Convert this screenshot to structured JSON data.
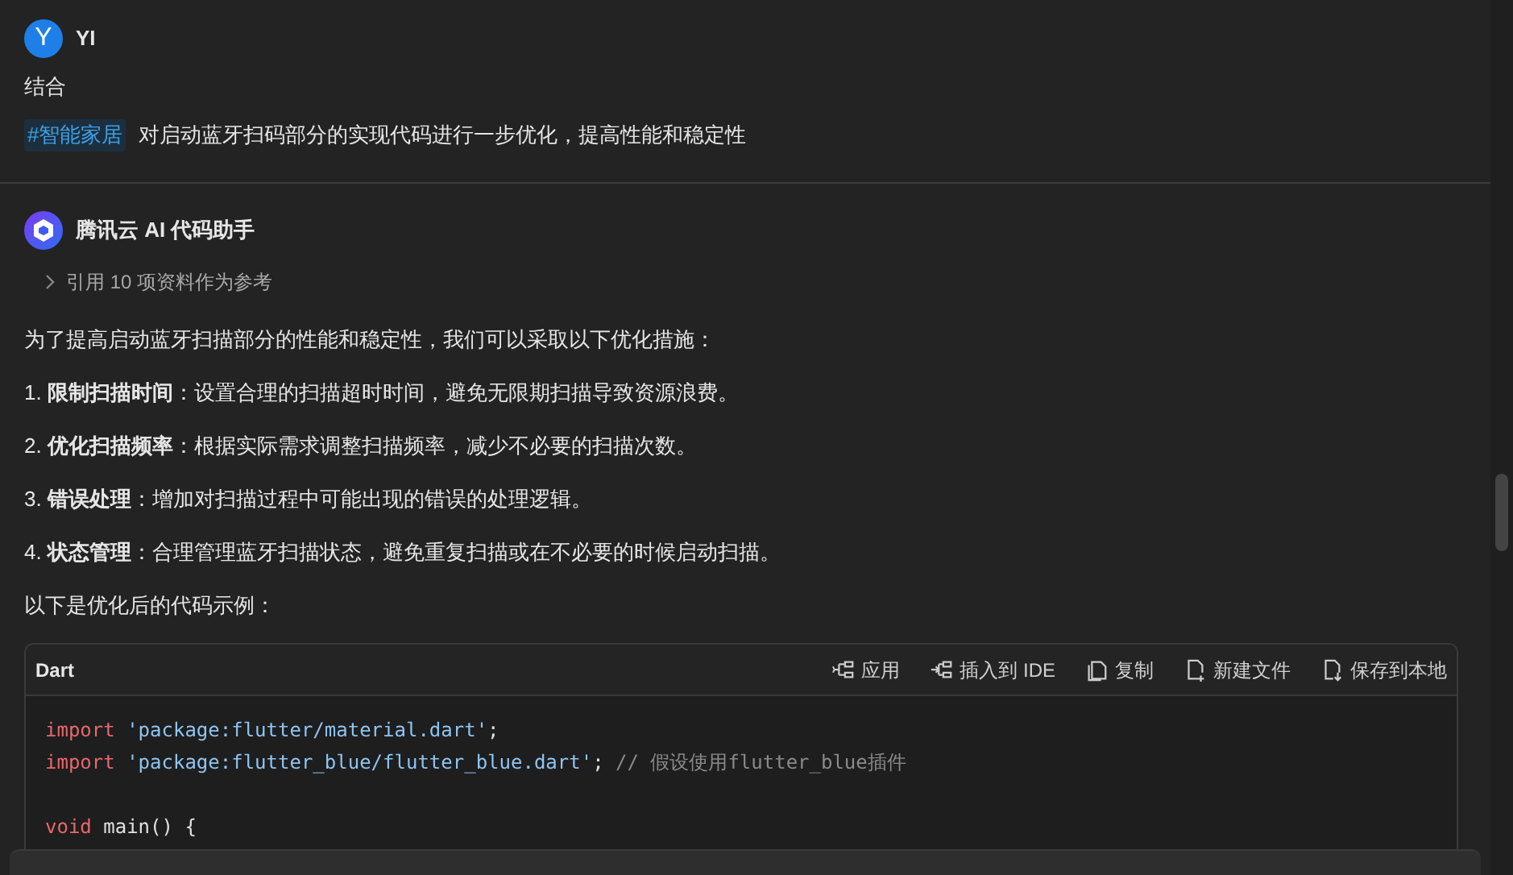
{
  "user_message": {
    "avatar_letter": "Y",
    "author": "YI",
    "lines": [
      "结合"
    ],
    "tag": "#智能家居",
    "prompt": "对启动蓝牙扫码部分的实现代码进行一步优化，提高性能和稳定性"
  },
  "assistant_message": {
    "author": "腾讯云 AI 代码助手",
    "references": {
      "label": "引用 10 项资料作为参考",
      "expanded": false
    },
    "paragraphs": [
      "为了提高启动蓝牙扫描部分的性能和稳定性，我们可以采取以下优化措施：",
      "1. **限制扫描时间**：设置合理的扫描超时时间，避免无限期扫描导致资源浪费。",
      "2. **优化扫描频率**：根据实际需求调整扫描频率，减少不必要的扫描次数。",
      "3. **错误处理**：增加对扫描过程中可能出现的错误的处理逻辑。",
      "4. **状态管理**：合理管理蓝牙扫描状态，避免重复扫描或在不必要的时候启动扫描。",
      "以下是优化后的代码示例："
    ],
    "code_block": {
      "language": "Dart",
      "actions": [
        {
          "kind": "apply",
          "label": "应用"
        },
        {
          "kind": "insert",
          "label": "插入到 IDE"
        },
        {
          "kind": "copy",
          "label": "复制"
        },
        {
          "kind": "new_file",
          "label": "新建文件"
        },
        {
          "kind": "save",
          "label": "保存到本地"
        }
      ],
      "lines": [
        {
          "blank_before": false,
          "tokens": [
            {
              "kind": "keyword",
              "text": "import"
            },
            {
              "kind": "string",
              "text": "'package:flutter/material.dart'"
            },
            {
              "kind": "plain",
              "text": ";"
            }
          ]
        },
        {
          "blank_before": false,
          "tokens": [
            {
              "kind": "keyword",
              "text": "import"
            },
            {
              "kind": "string",
              "text": "'package:flutter_blue/flutter_blue.dart'"
            },
            {
              "kind": "plain",
              "text": ";"
            },
            {
              "kind": "comment",
              "text": "// 假设使用flutter_blue插件"
            }
          ]
        },
        {
          "blank_before": true,
          "tokens": [
            {
              "kind": "keyword",
              "text": "void"
            },
            {
              "kind": "plain",
              "text": "main() {"
            }
          ]
        }
      ]
    }
  }
}
